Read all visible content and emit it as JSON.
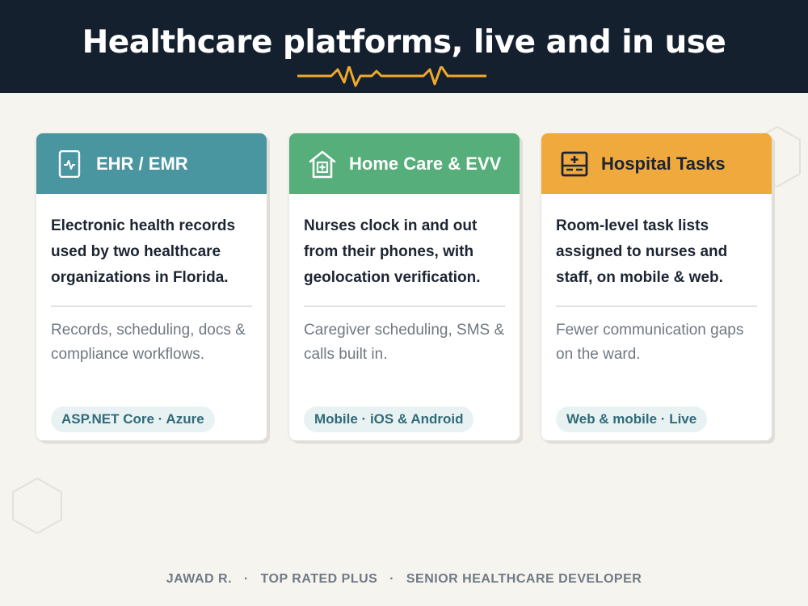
{
  "header": {
    "title": "Healthcare platforms, live and in use"
  },
  "colors": {
    "header_bg": "#15202f",
    "accent_pulse": "#f0a92a",
    "teal": "#4a96a0",
    "green": "#56ae7a",
    "amber": "#f0a93c",
    "badge_text": "#2f6b79"
  },
  "cards": [
    {
      "icon": "tablet-heartbeat-icon",
      "title": "EHR / EMR",
      "lead": "Electronic health records used by two healthcare organizations in Florida.",
      "sub": "Records, scheduling, docs & compliance workflows.",
      "badge": "ASP.NET Core · Azure"
    },
    {
      "icon": "house-medical-icon",
      "title": "Home Care & EVV",
      "lead": "Nurses clock in and out from their phones, with geolocation verification.",
      "sub": "Caregiver scheduling, SMS & calls built in.",
      "badge": "Mobile · iOS & Android"
    },
    {
      "icon": "hospital-board-icon",
      "title": "Hospital Tasks",
      "lead": "Room-level task lists assigned to nurses and staff, on mobile & web.",
      "sub": "Fewer communication gaps on the ward.",
      "badge": "Web & mobile · Live"
    }
  ],
  "footer": {
    "name": "JAWAD R.",
    "rating": "TOP RATED PLUS",
    "role": "SENIOR HEALTHCARE DEVELOPER"
  }
}
